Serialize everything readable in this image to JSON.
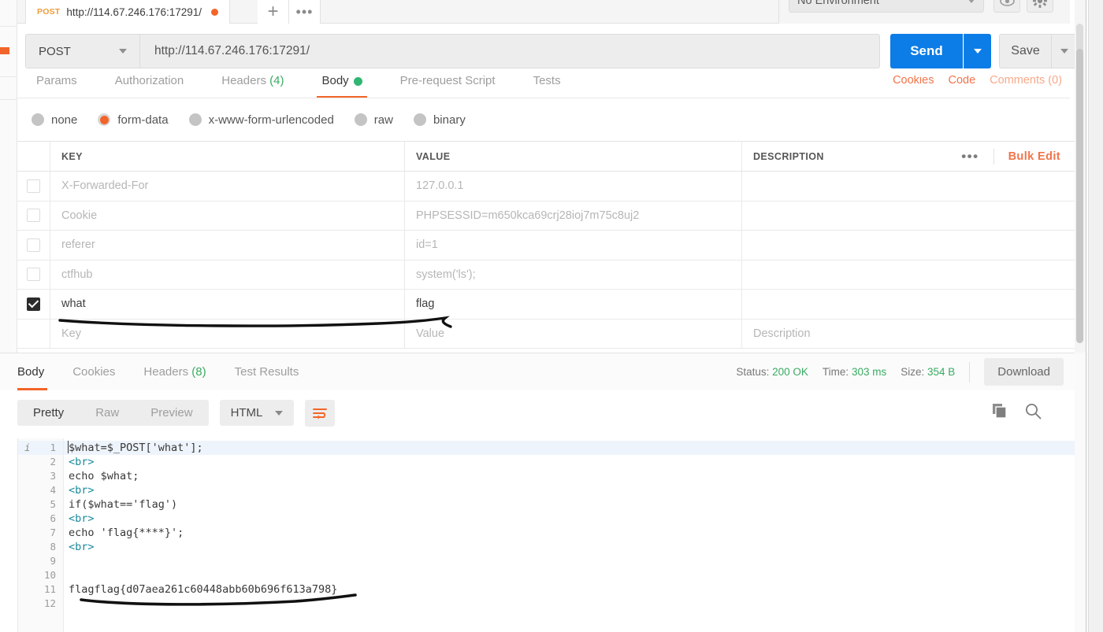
{
  "tab": {
    "method": "POST",
    "url": "http://114.67.246.176:17291/",
    "unsaved_dot": "unsaved",
    "new_tab": "+",
    "more": "•••"
  },
  "environment": {
    "selected": "No Environment",
    "eye_icon": "eye-icon",
    "gear_icon": "gear-icon"
  },
  "request": {
    "method": "POST",
    "url": "http://114.67.246.176:17291/",
    "send_label": "Send",
    "save_label": "Save"
  },
  "request_tabs": [
    {
      "label": "Params",
      "active": false
    },
    {
      "label": "Authorization",
      "active": false
    },
    {
      "label": "Headers",
      "count": "(4)",
      "active": false
    },
    {
      "label": "Body",
      "active": true,
      "dot": true
    },
    {
      "label": "Pre-request Script",
      "active": false
    },
    {
      "label": "Tests",
      "active": false
    }
  ],
  "request_tabs_right": [
    {
      "label": "Cookies",
      "muted": false
    },
    {
      "label": "Code",
      "muted": false
    },
    {
      "label": "Comments (0)",
      "muted": true
    }
  ],
  "body_types": [
    {
      "label": "none",
      "selected": false
    },
    {
      "label": "form-data",
      "selected": true
    },
    {
      "label": "x-www-form-urlencoded",
      "selected": false
    },
    {
      "label": "raw",
      "selected": false
    },
    {
      "label": "binary",
      "selected": false
    }
  ],
  "kv_table": {
    "headers": {
      "key": "KEY",
      "value": "VALUE",
      "description": "DESCRIPTION"
    },
    "dots": "•••",
    "bulk_edit": "Bulk Edit",
    "rows": [
      {
        "checked": false,
        "key": "X-Forwarded-For",
        "value": "127.0.0.1",
        "description": ""
      },
      {
        "checked": false,
        "key": "Cookie",
        "value": "PHPSESSID=m650kca69crj28ioj7m75c8uj2",
        "description": ""
      },
      {
        "checked": false,
        "key": "referer",
        "value": "id=1",
        "description": ""
      },
      {
        "checked": false,
        "key": "ctfhub",
        "value": "system('ls');",
        "description": ""
      },
      {
        "checked": true,
        "key": "what",
        "value": "flag",
        "description": ""
      }
    ],
    "placeholder_row": {
      "key": "Key",
      "value": "Value",
      "description": "Description"
    }
  },
  "response_tabs": [
    {
      "label": "Body",
      "active": true
    },
    {
      "label": "Cookies",
      "active": false
    },
    {
      "label": "Headers",
      "count": "(8)",
      "active": false
    },
    {
      "label": "Test Results",
      "active": false
    }
  ],
  "response_meta": {
    "status_label": "Status:",
    "status_value": "200 OK",
    "time_label": "Time:",
    "time_value": "303 ms",
    "size_label": "Size:",
    "size_value": "354 B",
    "download_label": "Download"
  },
  "pretty_bar": {
    "modes": [
      {
        "label": "Pretty",
        "active": true
      },
      {
        "label": "Raw",
        "active": false
      },
      {
        "label": "Preview",
        "active": false
      }
    ],
    "format": "HTML",
    "wrap_icon": "word-wrap-icon",
    "copy_icon": "copy-icon",
    "search_icon": "search-icon"
  },
  "code": {
    "info_icon": "i",
    "lines": [
      {
        "n": "1",
        "text": "$what=$_POST['what'];",
        "tag": false
      },
      {
        "n": "2",
        "text": "<br>",
        "tag": true
      },
      {
        "n": "3",
        "text": "echo $what;",
        "tag": false
      },
      {
        "n": "4",
        "text": "<br>",
        "tag": true
      },
      {
        "n": "5",
        "text": "if($what=='flag')",
        "tag": false
      },
      {
        "n": "6",
        "text": "<br>",
        "tag": true
      },
      {
        "n": "7",
        "text": "echo 'flag{****}';",
        "tag": false
      },
      {
        "n": "8",
        "text": "<br>",
        "tag": true
      },
      {
        "n": "9",
        "text": "",
        "tag": false
      },
      {
        "n": "10",
        "text": "",
        "tag": false
      },
      {
        "n": "11",
        "text": "flagflag{d07aea261c60448abb60b696f613a798}",
        "tag": false
      },
      {
        "n": "12",
        "text": "",
        "tag": false
      }
    ]
  },
  "annotations": [
    {
      "name": "underline-what-row"
    },
    {
      "name": "underline-flag-value"
    }
  ],
  "colors": {
    "accent_orange": "#f2652a",
    "send_blue": "#0c7ce6",
    "status_green": "#3aab62",
    "link_orange": "#f2744a"
  }
}
